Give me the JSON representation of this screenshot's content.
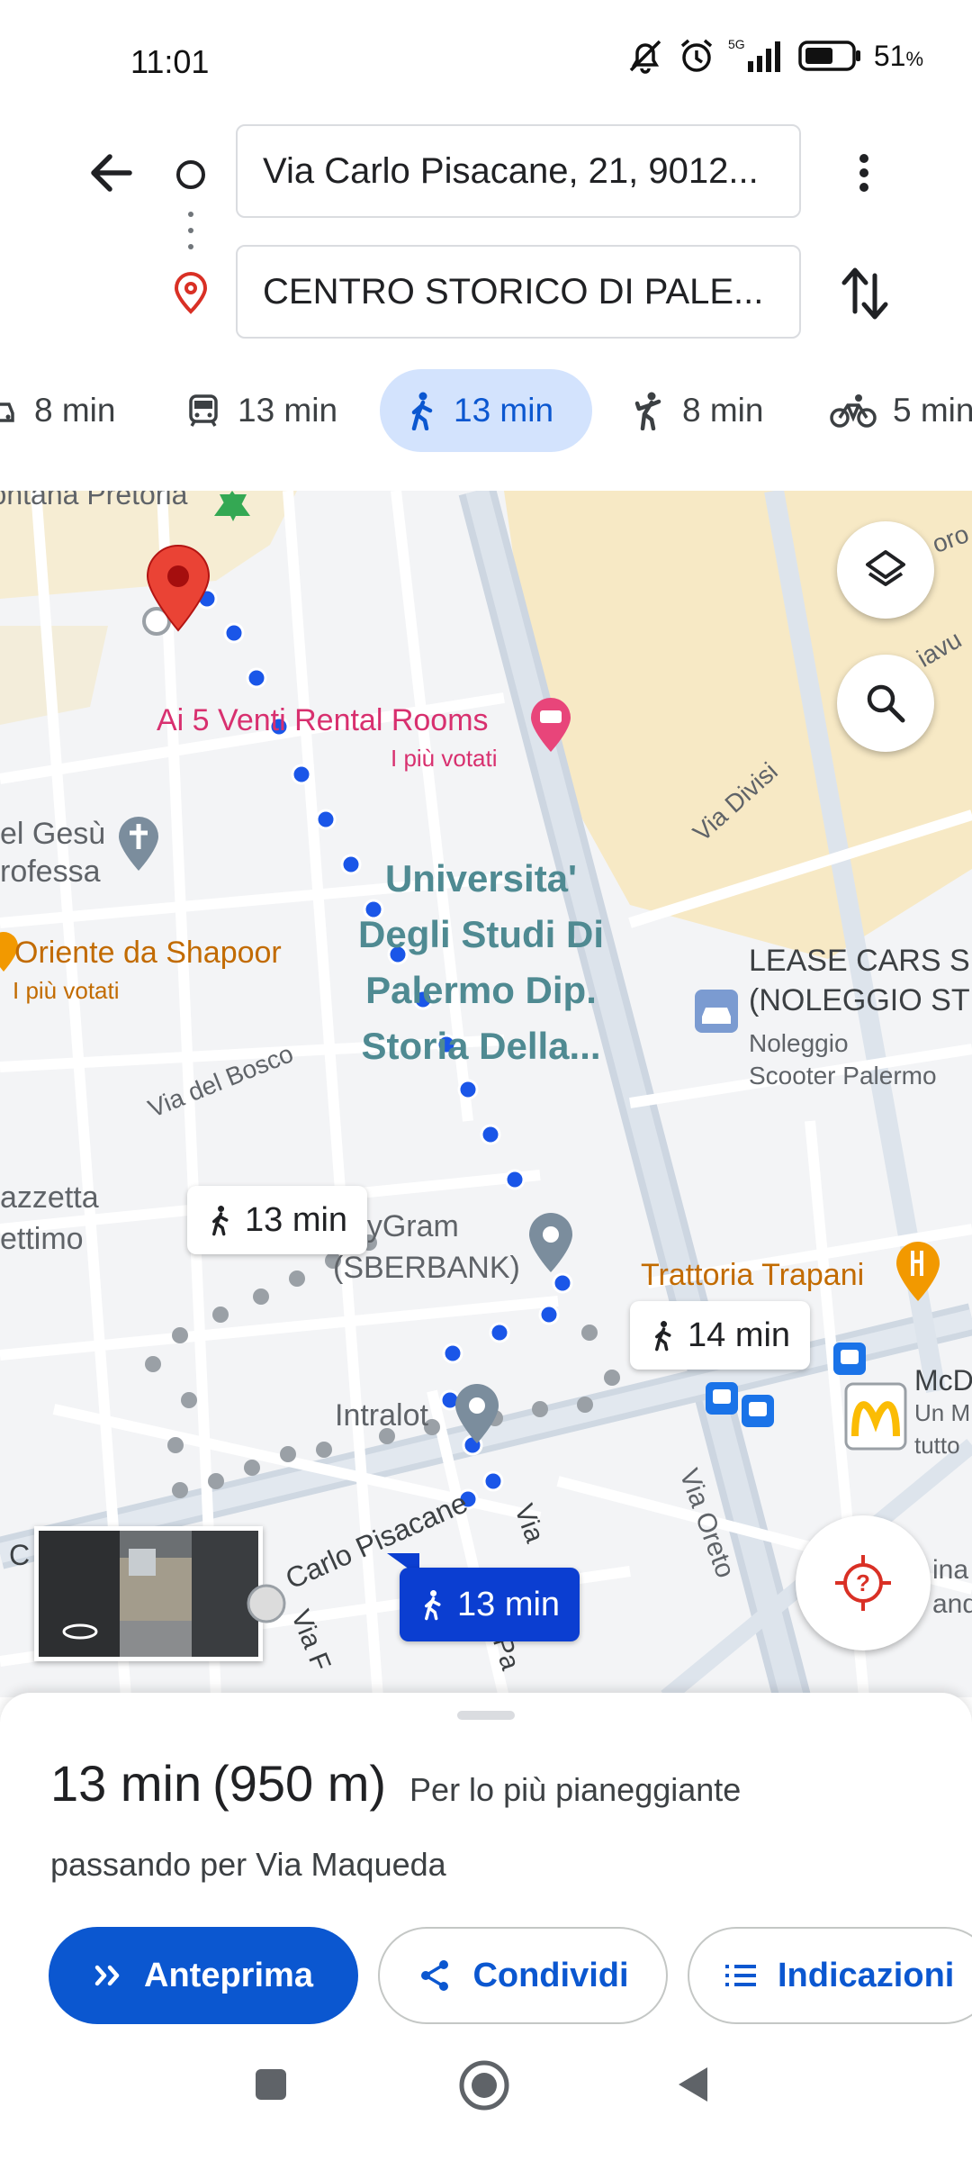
{
  "status": {
    "time": "11:01",
    "battery": "51",
    "battery_unit": "%",
    "net": "5G"
  },
  "route": {
    "origin": "Via Carlo Pisacane, 21, 9012...",
    "destination": "CENTRO STORICO DI PALE..."
  },
  "modes": [
    {
      "icon": "car-icon",
      "label": "8 min"
    },
    {
      "icon": "transit-icon",
      "label": "13 min"
    },
    {
      "icon": "walk-icon",
      "label": "13 min",
      "selected": true
    },
    {
      "icon": "ride-icon",
      "label": "8 min"
    },
    {
      "icon": "bike-icon",
      "label": "5 min"
    }
  ],
  "map": {
    "labels": {
      "pretoria": "Fontana Pretoria",
      "ai5venti": "Ai 5 Venti Rental Rooms",
      "ai5venti_sub": "I più votati",
      "gesu1": "el Gesù",
      "gesu2": "rofessa",
      "uni1": "Universita'",
      "uni2": "Degli Studi Di",
      "uni3": "Palermo Dip.",
      "uni4": "Storia Della...",
      "oriente": "Oriente da Shapoor",
      "oriente_sub": "I più votati",
      "lease1": "LEASE CARS S.",
      "lease2": "(NOLEGGIO ST",
      "lease3": "Noleggio",
      "lease4": "Scooter Palermo",
      "viabosco": "Via del Bosco",
      "viadivisi": "Via Divisi",
      "giavu": "iavu",
      "oro": "oro",
      "piazzetta1": "azzetta",
      "piazzetta2": "ettimo",
      "moneygram1": "neyGram",
      "moneygram2": "(SBERBANK)",
      "trattoria": "Trattoria Trapani",
      "intralot": "Intralot",
      "viaoreto": "Via Oreto",
      "mcd1": "McD",
      "mcd2": "Un M",
      "mcd3": "tutto",
      "ina": "ina",
      "and": "and",
      "pisacane": "Carlo Pisacane",
      "viaupper": "Via",
      "viaf": "Via F",
      "vialower": "Via",
      "letter_c": "C",
      "viapa": "Via Pa"
    },
    "bubbles": {
      "alt1": "13 min",
      "alt2": "14 min",
      "selected": "13 min"
    }
  },
  "summary": {
    "duration": "13 min",
    "distance": "(950 m)",
    "note": "Per lo più pianeggiante",
    "via": "passando per Via Maqueda"
  },
  "actions": {
    "preview": "Anteprima",
    "share": "Condividi",
    "directions": "Indicazioni"
  }
}
